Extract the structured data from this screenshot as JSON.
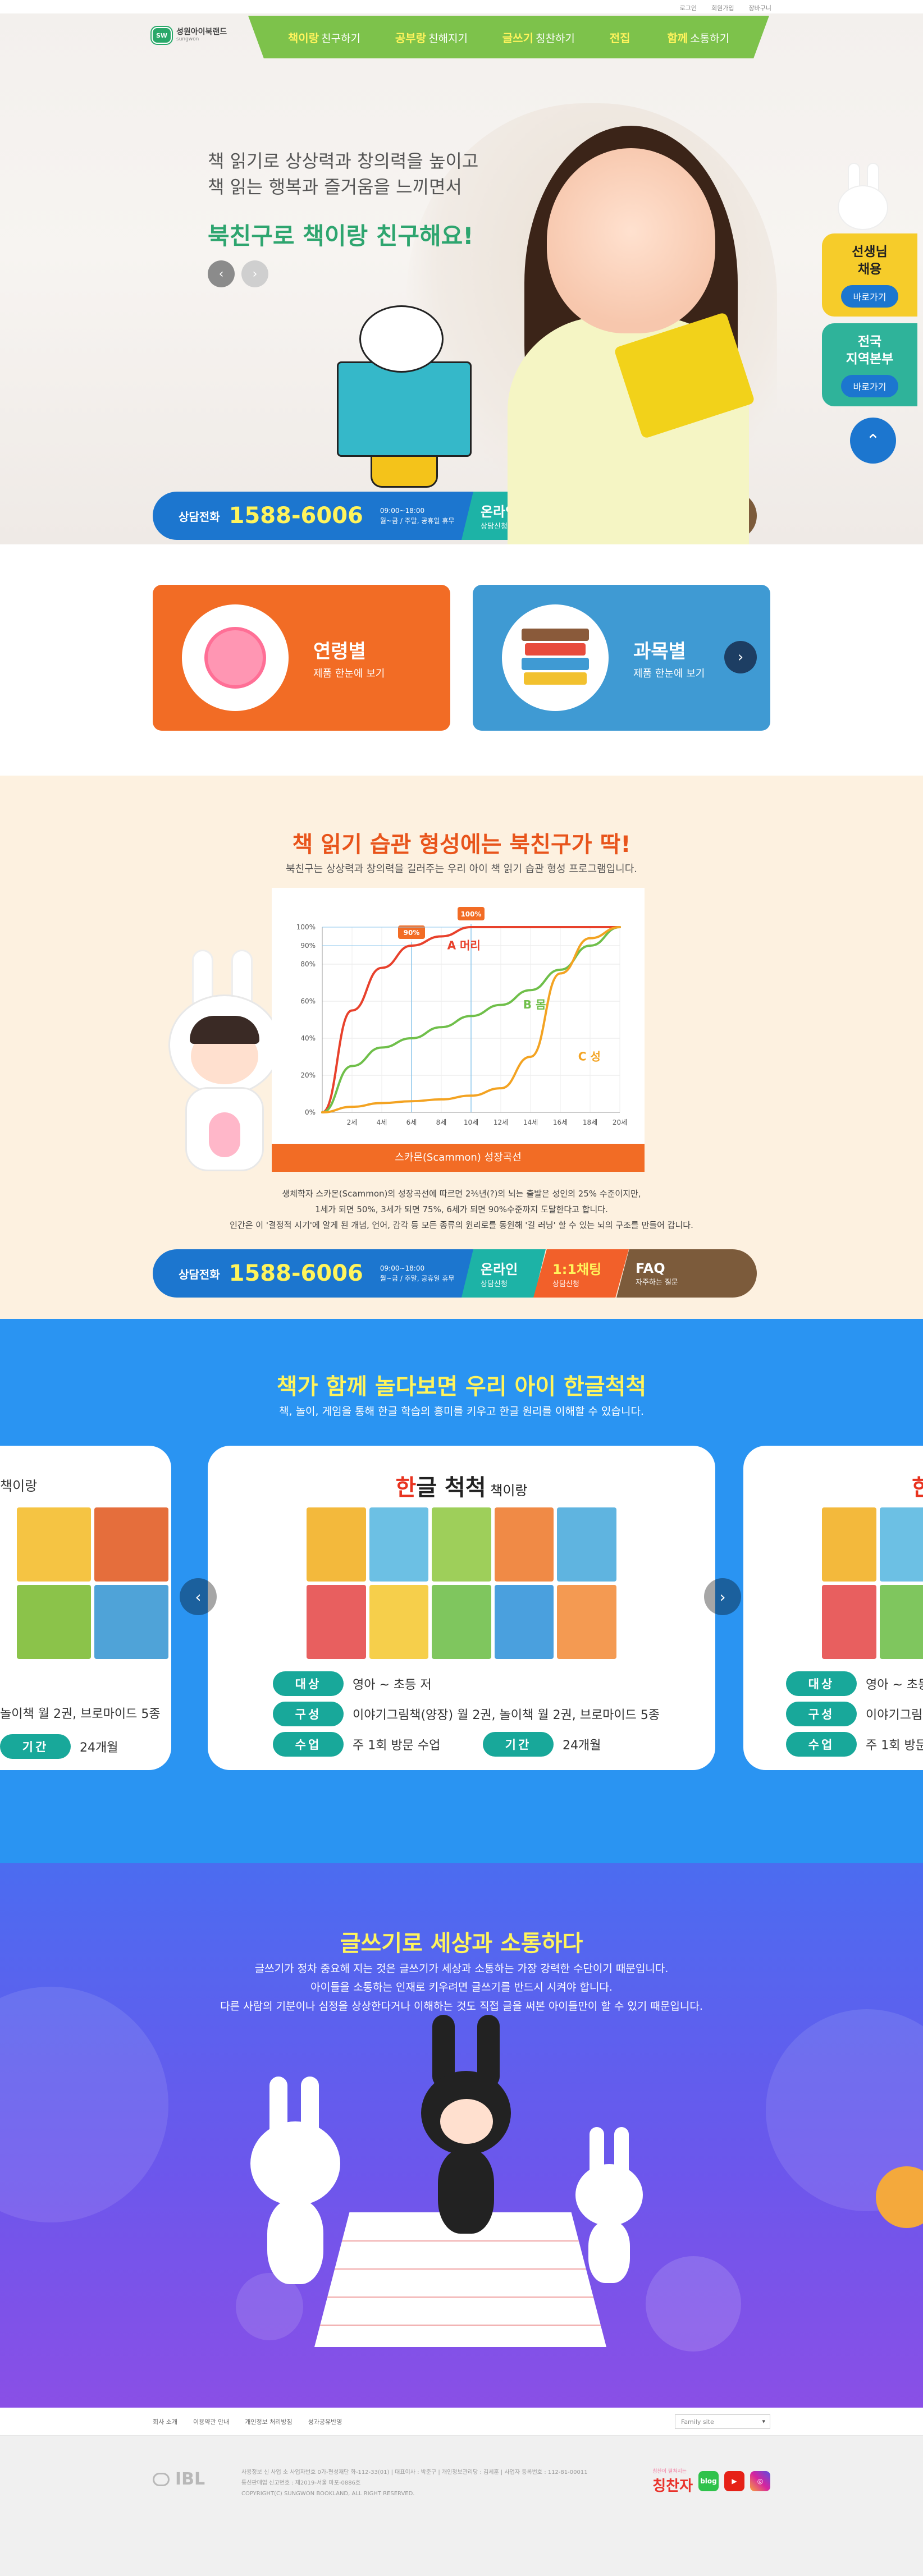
{
  "util_links": [
    "로그인",
    "회원가입",
    "장바구니"
  ],
  "logo": {
    "badge": "SW",
    "name": "성원아이북랜드",
    "sub": "sungwon"
  },
  "gnb": [
    {
      "hi": "책이랑",
      "sub": "친구하기"
    },
    {
      "hi": "공부랑",
      "sub": "친해지기"
    },
    {
      "hi": "글쓰기",
      "sub": "칭찬하기"
    },
    {
      "hi": "전집",
      "sub": ""
    },
    {
      "hi": "함께",
      "sub": "소통하기"
    }
  ],
  "hero": {
    "line1": "책 읽기로 상상력과 창의력을 높이고",
    "line2": "책 읽는 행복과 즐거움을 느끼면서",
    "line3": "북친구로 책이랑 친구해요!"
  },
  "side": {
    "card1_title": "선생님\n채용",
    "card1_btn": "바로가기",
    "card2_title": "전국\n지역본부",
    "card2_btn": "바로가기"
  },
  "contact": {
    "label": "상담전화",
    "number": "1588-6006",
    "hours1": "09:00~18:00",
    "hours2": "월~금 / 주말, 공휴일 휴무",
    "online_t": "온라인",
    "online_s": "상담신청",
    "chat_t": "1:1채팅",
    "chat_s": "상담신청",
    "faq_t": "FAQ",
    "faq_s": "자주하는 질문"
  },
  "categories": [
    {
      "title": "연령별",
      "sub": "제품 한눈에 보기"
    },
    {
      "title": "과목별",
      "sub": "제품 한눈에 보기"
    }
  ],
  "habit": {
    "title": "책 읽기 습관 형성에는 북친구가 딱!",
    "sub": "북친구는 상상력과 창의력을 길러주는 우리 아이 책 읽기 습관 형성 프로그램입니다.",
    "desc1": "생체학자 스카몬(Scammon)의 성장곡선에 따르면 2⅗년(?)의 뇌는 출발은 성인의 25% 수준이지만,",
    "desc2": "1세가 되면 50%, 3세가 되면 75%, 6세가 되면 90%수준까지 도달한다고 합니다.",
    "desc3": "인간은 이 '결정적 시기'에 알게 된 개념, 언어, 감각 등 모든 종류의 원리로를 동원해 '길 러닝' 할 수 있는 뇌의 구조를 만들어 갑니다.",
    "caption": "스카몬(Scammon) 성장곡선"
  },
  "chart_data": {
    "type": "line",
    "title": "",
    "xlabel": "",
    "ylabel": "",
    "x": [
      "2세",
      "4세",
      "6세",
      "8세",
      "10세",
      "12세",
      "14세",
      "16세",
      "18세",
      "20세"
    ],
    "x_numeric": [
      0,
      2,
      4,
      6,
      8,
      10,
      12,
      14,
      16,
      18,
      20
    ],
    "y_ticks": [
      "0%",
      "20%",
      "40%",
      "60%",
      "80%",
      "90%",
      "100%"
    ],
    "ylim": [
      0,
      100
    ],
    "annotations": [
      {
        "label": "90%",
        "x": 6,
        "y": 90
      },
      {
        "label": "100%",
        "x": 10,
        "y": 100
      }
    ],
    "series": [
      {
        "name": "A 머리",
        "color": "#e8412c",
        "values": [
          0,
          55,
          78,
          90,
          95,
          100,
          100,
          100,
          100,
          100,
          100
        ]
      },
      {
        "name": "B 몸",
        "color": "#6fbf4a",
        "values": [
          0,
          25,
          35,
          40,
          46,
          52,
          58,
          66,
          77,
          90,
          100
        ]
      },
      {
        "name": "C 성",
        "color": "#f3a322",
        "values": [
          0,
          3,
          5,
          6,
          7,
          9,
          13,
          30,
          75,
          94,
          100
        ]
      }
    ],
    "grid": true
  },
  "hangul": {
    "title": "책가 함께 놀다보면 우리 아이 한글척척",
    "sub": "책, 놀이, 게임을 통해 한글 학습의 흥미를 키우고 한글 원리를 이해할 수 있습니다.",
    "card_title_red": "한",
    "card_title_rest": "글 척척",
    "card_title_small": " 책이랑",
    "left_title": "책이랑",
    "left_line": "놀이책 월 2권, 브로마이드 5종",
    "left_period": "24개월",
    "right_title": "한",
    "info": {
      "target_label": "대상",
      "target": "영아 ~ 초등 저",
      "comp_label": "구성",
      "comp": "이야기그림책(양장) 월 2권, 놀이책 월 2권, 브로마이드 5종",
      "class_label": "수업",
      "class": "주 1회 방문 수업",
      "period_label": "기간",
      "period": "24개월",
      "right_target": "영아 ~ 초등",
      "right_comp": "이야기그림책(",
      "right_class": "주 1회 방문 수"
    }
  },
  "writing": {
    "title": "글쓰기로 세상과 소통하다",
    "d1": "글쓰기가 정차 중요해 지는 것은 글쓰기가 세상과 소통하는 가장 강력한 수단이기 때문입니다.",
    "d2": "아이들을 소통하는 인재로 키우려면 글쓰기를 반드시 시켜야 합니다.",
    "d3": "다른 사람의 기분이나 심정을 상상한다거나 이해하는 것도 직접 글을 써본 아이들만이 할 수 있기 때문입니다."
  },
  "footer": {
    "links": [
      "회사 소개",
      "이용약관 안내",
      "개인정보 처리방침",
      "성과공유반영"
    ],
    "family": "Family site",
    "logo": "IBL",
    "info1": "사용정보 신 사업 소 사업자번호 0가-편성재단 화-112-33(01) | 대표이사 : 박준구 | 개인정보관리당 : 김세훈 | 사업자 등록번호 : 112-81-00011",
    "info2": "통신판매업 신고번호 : 제2019-서울 마포-0886호",
    "info3": "COPYRIGHT(C) SUNGWON BOOKLAND, ALL RIGHT RESERVED.",
    "brand": "칭찬자",
    "brand_sub": "칭찬이 펼쳐지는",
    "sns": [
      "blog",
      "▶",
      "◎"
    ]
  },
  "colors": {
    "green": "#7dc24b",
    "blue": "#1c76cf",
    "orange": "#f26c25",
    "teal": "#18a89a",
    "yellow": "#fff45c"
  }
}
